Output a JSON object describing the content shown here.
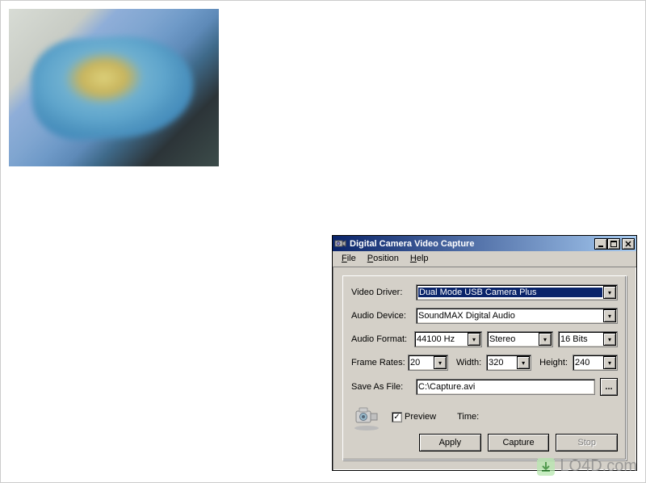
{
  "preview_alt": "Webcam preview showing a world map",
  "window": {
    "title": "Digital Camera Video Capture",
    "minimize": "_",
    "maximize": "□",
    "close": "×"
  },
  "menu": {
    "file": "File",
    "position": "Position",
    "help": "Help"
  },
  "form": {
    "video_driver": {
      "label": "Video Driver:",
      "value": "Dual Mode USB Camera Plus"
    },
    "audio_device": {
      "label": "Audio Device:",
      "value": "SoundMAX Digital Audio"
    },
    "audio_format": {
      "label": "Audio Format:",
      "hz": "44100 Hz",
      "channels": "Stereo",
      "bits": "16 Bits"
    },
    "frame_rates": {
      "label": "Frame Rates:",
      "fps": "20",
      "width_label": "Width:",
      "width": "320",
      "height_label": "Height:",
      "height": "240"
    },
    "save_as": {
      "label": "Save As File:",
      "path": "C:\\Capture.avi",
      "browse": "..."
    },
    "preview": {
      "checked": "✓",
      "label": "Preview"
    },
    "time_label": "Time:",
    "time_value": "",
    "apply": "Apply",
    "capture": "Capture",
    "stop": "Stop"
  },
  "watermark": {
    "text": "LO4D.com",
    "arrow": "↓"
  }
}
